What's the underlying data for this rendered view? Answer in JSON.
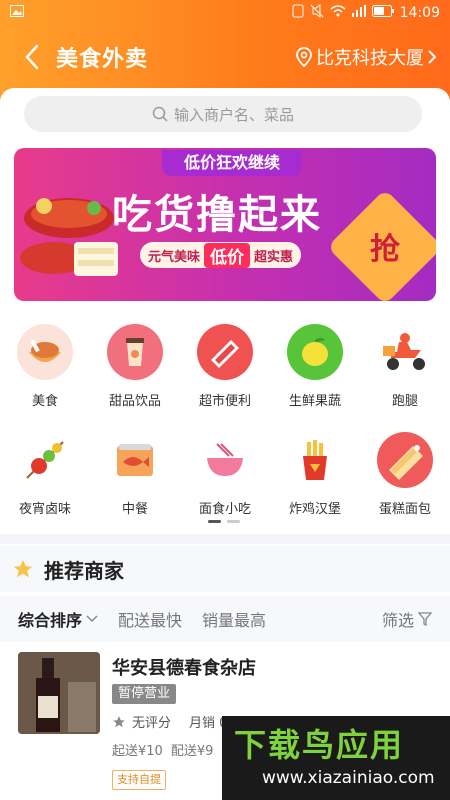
{
  "status": {
    "time": "14:09"
  },
  "header": {
    "title": "美食外卖",
    "location": "比克科技大厦"
  },
  "search": {
    "placeholder": "输入商户名、菜品"
  },
  "banner": {
    "top_text": "低价狂欢继续",
    "main_text": "吃货撸起来",
    "sub_left": "元气美味",
    "sub_mid": "低价",
    "sub_right": "超实惠",
    "grab": "抢"
  },
  "categories": [
    {
      "label": "美食",
      "icon": "bowl-icon",
      "color": "#f47b5a"
    },
    {
      "label": "甜品饮品",
      "icon": "drink-icon",
      "color": "#f26f7e"
    },
    {
      "label": "超市便利",
      "icon": "grocery-icon",
      "color": "#f05252"
    },
    {
      "label": "生鲜果蔬",
      "icon": "lemon-icon",
      "color": "#58c43a"
    },
    {
      "label": "跑腿",
      "icon": "scooter-icon",
      "color": "#ffffff"
    },
    {
      "label": "夜宵卤味",
      "icon": "skewer-icon",
      "color": "#ffffff"
    },
    {
      "label": "中餐",
      "icon": "fish-can-icon",
      "color": "#ffffff"
    },
    {
      "label": "面食小吃",
      "icon": "noodle-icon",
      "color": "#ffffff"
    },
    {
      "label": "炸鸡汉堡",
      "icon": "fries-icon",
      "color": "#ffffff"
    },
    {
      "label": "蛋糕面包",
      "icon": "cake-icon",
      "color": "#f05a5a"
    }
  ],
  "recommend": {
    "title": "推荐商家"
  },
  "sort": {
    "items": [
      "综合排序",
      "配送最快",
      "销量最高"
    ],
    "filter": "筛选"
  },
  "shop": {
    "name": "华安县德春食杂店",
    "status": "暂停营业",
    "rating": "无评分",
    "monthly_sales": "月销 0",
    "min_order": "起送¥10",
    "delivery_fee": "配送¥9",
    "tag": "支持自提"
  },
  "watermark": {
    "title": "下载鸟应用",
    "url": "www.xiazainiao.com"
  }
}
